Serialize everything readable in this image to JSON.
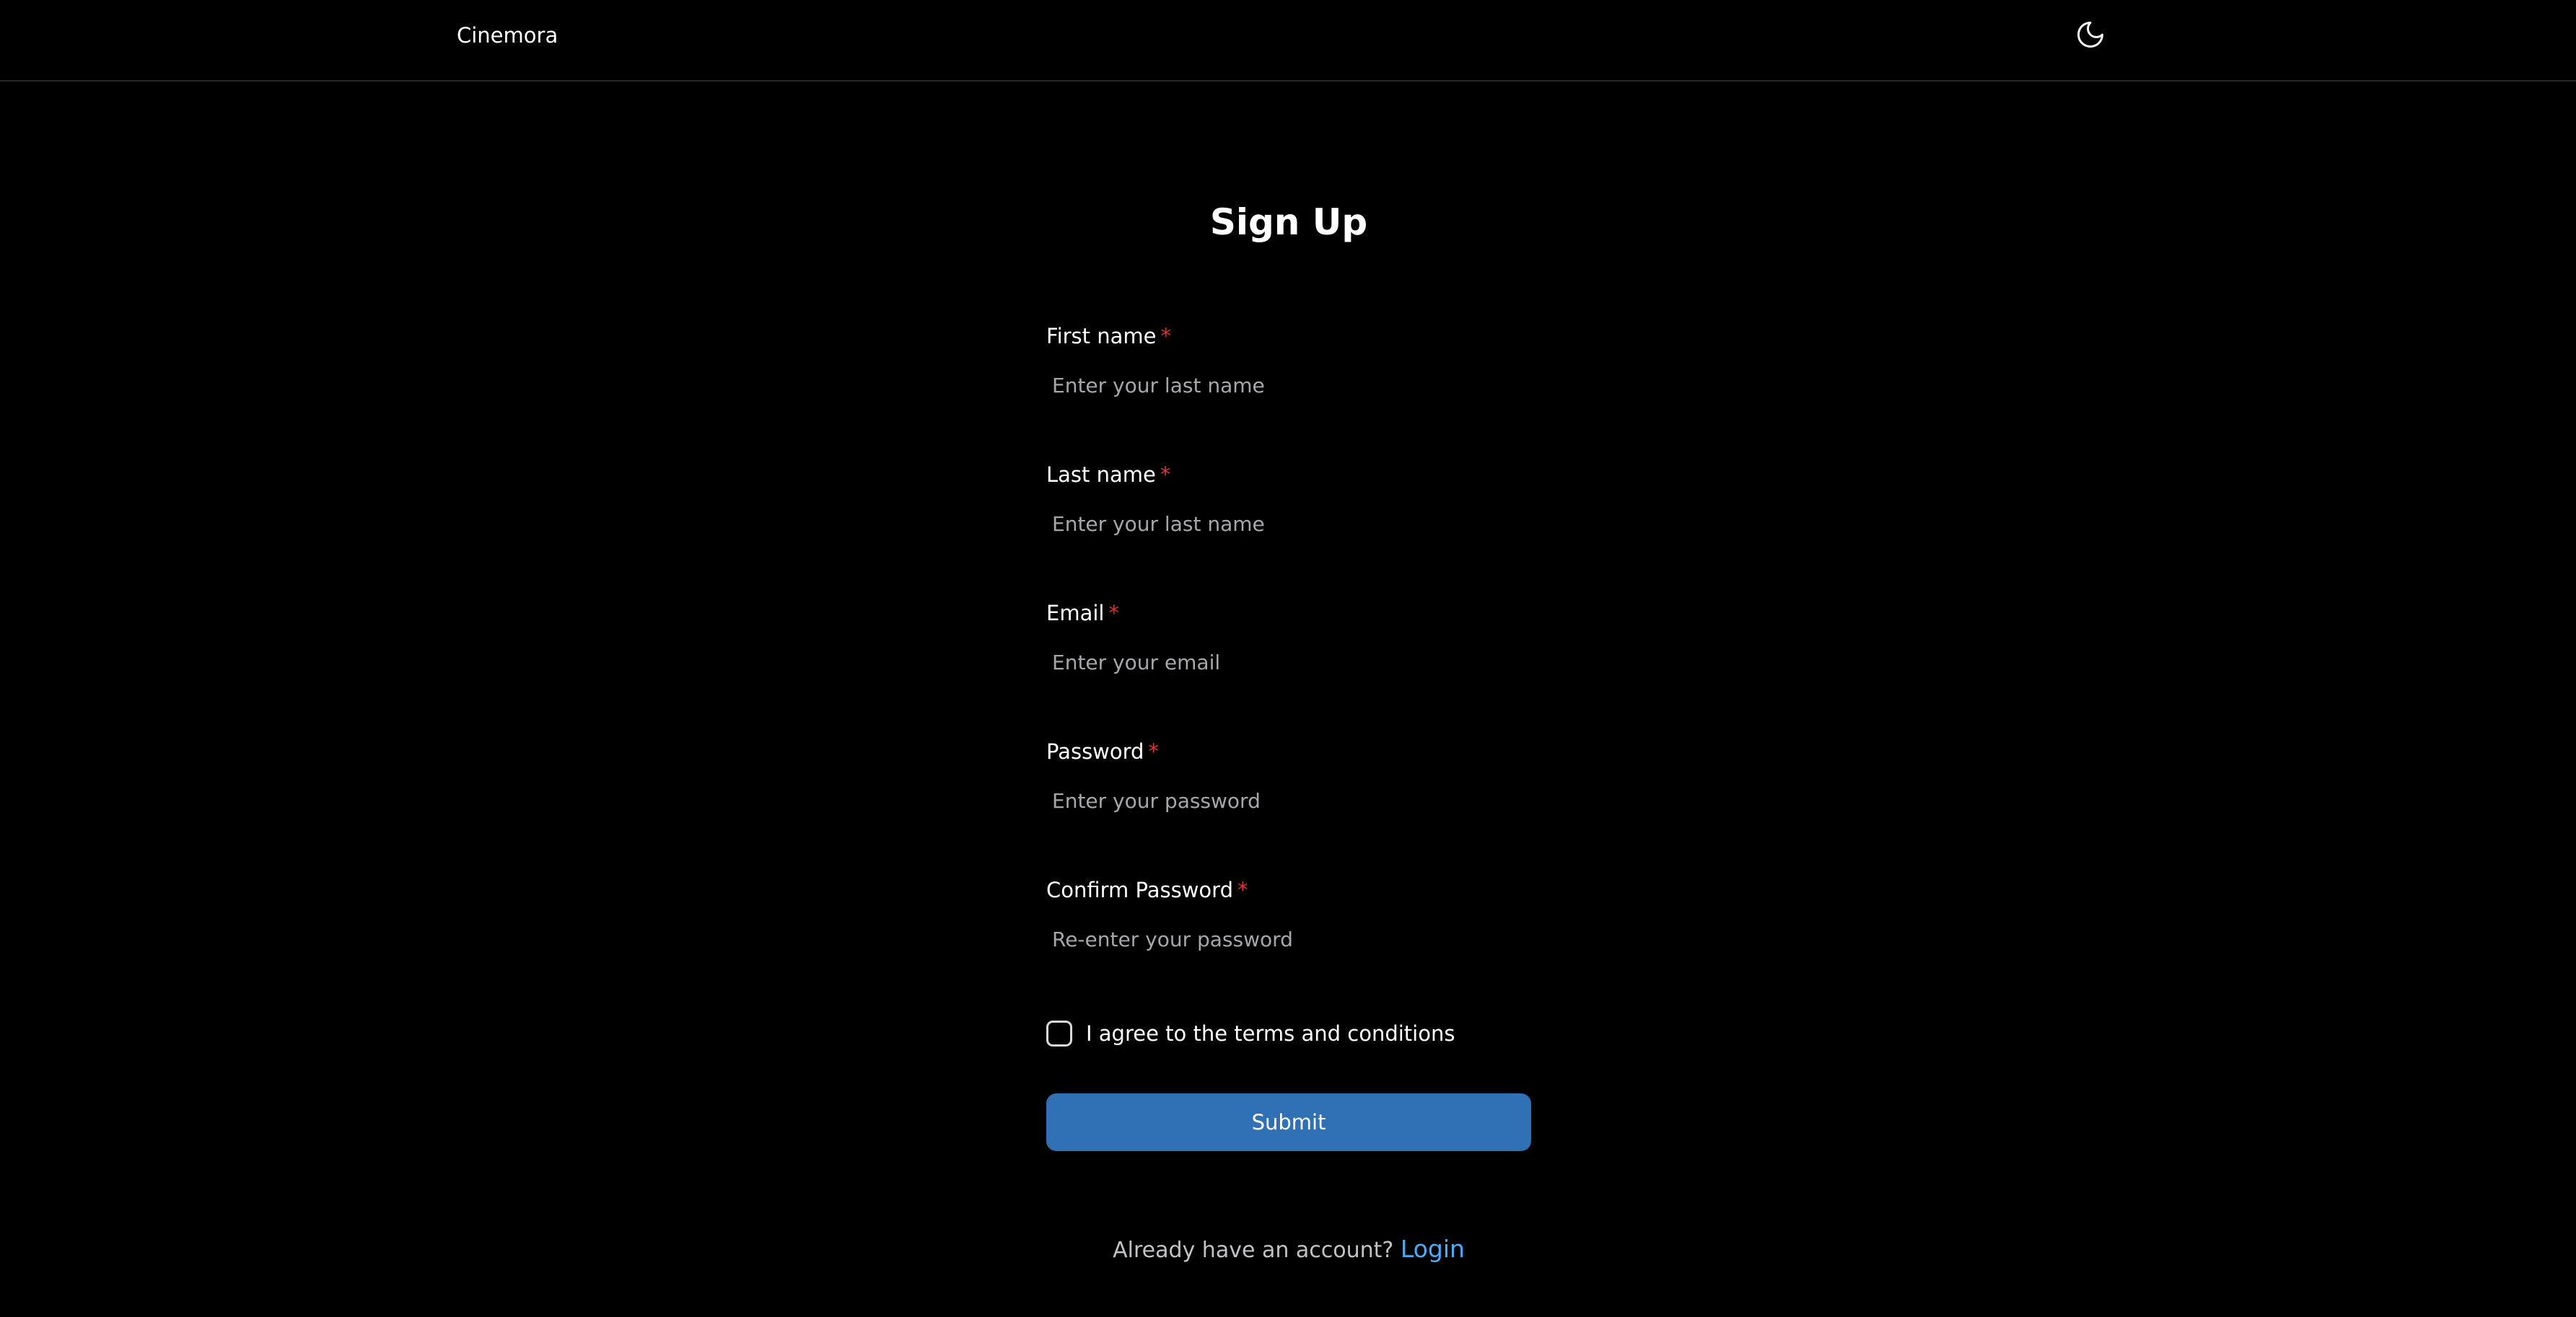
{
  "app": {
    "brand": "Cinemora",
    "theme_toggle_icon": "moon-icon"
  },
  "form": {
    "title": "Sign Up",
    "required_marker": "*",
    "fields": [
      {
        "label": "First name",
        "placeholder": "Enter your last name",
        "value": ""
      },
      {
        "label": "Last name",
        "placeholder": "Enter your last name",
        "value": ""
      },
      {
        "label": "Email",
        "placeholder": "Enter your email",
        "value": ""
      },
      {
        "label": "Password",
        "placeholder": "Enter your password",
        "value": ""
      },
      {
        "label": "Confirm Password",
        "placeholder": "Re-enter your password",
        "value": ""
      }
    ],
    "terms": {
      "label": "I agree to the terms and conditions",
      "checked": false
    },
    "submit_label": "Submit",
    "login_prompt": "Already have an account?",
    "login_link": "Login"
  },
  "colors": {
    "background": "#000000",
    "accent": "#2f71b4",
    "link": "#4dabf7",
    "required": "#e03131"
  }
}
